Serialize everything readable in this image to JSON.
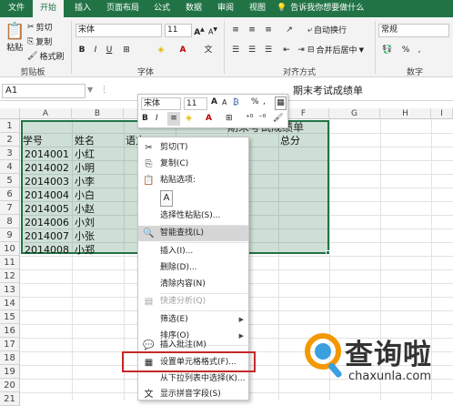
{
  "tabs": [
    "文件",
    "开始",
    "插入",
    "页面布局",
    "公式",
    "数据",
    "审阅",
    "视图"
  ],
  "tell_me": "告诉我你想要做什么",
  "ribbon": {
    "paste": "粘贴",
    "cut": "剪切",
    "copy": "复制",
    "format_painter": "格式刷",
    "font_name": "宋体",
    "font_size": "11",
    "wrap_text": "自动换行",
    "merge_center": "合并后居中",
    "number_format": "常规",
    "groups": {
      "clipboard": "剪贴板",
      "font": "字体",
      "alignment": "对齐方式",
      "number": "数字"
    }
  },
  "formula_bar": {
    "name_box": "A1",
    "content": "期末考试成绩单"
  },
  "columns": [
    "A",
    "B",
    "C",
    "D",
    "E",
    "F",
    "G",
    "H",
    "I"
  ],
  "rows": [
    "1",
    "2",
    "3",
    "4",
    "5",
    "6",
    "7",
    "8",
    "9",
    "10",
    "11",
    "12",
    "13",
    "14",
    "15",
    "16",
    "17",
    "18",
    "19",
    "20",
    "21"
  ],
  "sheet": {
    "title_partial": "期末考试成绩单",
    "headers": {
      "id": "学号",
      "name": "姓名",
      "yuwen": "语文",
      "total": "总分"
    },
    "students": [
      {
        "id": "2014001",
        "name": "小红"
      },
      {
        "id": "2014002",
        "name": "小明"
      },
      {
        "id": "2014003",
        "name": "小李"
      },
      {
        "id": "2014004",
        "name": "小白"
      },
      {
        "id": "2014005",
        "name": "小赵"
      },
      {
        "id": "2014006",
        "name": "小刘"
      },
      {
        "id": "2014007",
        "name": "小张"
      },
      {
        "id": "2014008",
        "name": "小郑"
      }
    ]
  },
  "mini_toolbar": {
    "font": "宋体",
    "size": "11"
  },
  "context_menu": {
    "cut": "剪切(T)",
    "copy": "复制(C)",
    "paste_options": "粘贴选项:",
    "paste_special": "选择性粘贴(S)...",
    "smart_lookup": "智能查找(L)",
    "insert": "插入(I)...",
    "delete": "删除(D)...",
    "clear": "清除内容(N)",
    "quick_analysis": "快速分析(Q)",
    "filter": "筛选(E)",
    "sort": "排序(O)",
    "insert_comment": "插入批注(M)",
    "format_cells": "设置单元格格式(F)...",
    "pick_list": "从下拉列表中选择(K)...",
    "phonetic": "显示拼音字段(S)"
  },
  "watermark": {
    "brand": "查询啦",
    "domain": "chaxunla.com"
  },
  "colors": {
    "excel_green": "#217346",
    "highlight_red": "#c62828",
    "wm_orange": "#f39800"
  }
}
